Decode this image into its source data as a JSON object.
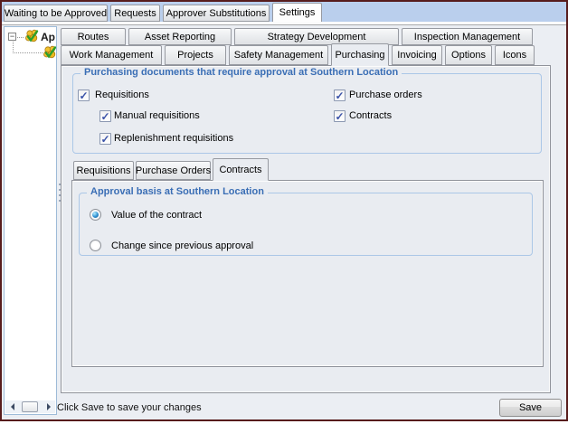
{
  "top_tabs": [
    {
      "label": "Waiting to be Approved",
      "active": false
    },
    {
      "label": "Requests",
      "active": false
    },
    {
      "label": "Approver Substitutions",
      "active": false
    },
    {
      "label": "Settings",
      "active": true
    }
  ],
  "tree": {
    "root_label": "Ap",
    "expander_glyph": "−"
  },
  "settings_tabs": {
    "row1": [
      {
        "label": "Routes"
      },
      {
        "label": "Asset Reporting"
      },
      {
        "label": "Strategy Development"
      },
      {
        "label": "Inspection Management"
      }
    ],
    "row2": [
      {
        "label": "Work Management",
        "active": false
      },
      {
        "label": "Projects",
        "active": false
      },
      {
        "label": "Safety Management",
        "active": false
      },
      {
        "label": "Purchasing",
        "active": true
      },
      {
        "label": "Invoicing",
        "active": false
      },
      {
        "label": "Options",
        "active": false
      },
      {
        "label": "Icons",
        "active": false
      }
    ]
  },
  "purchasing_page": {
    "group_title": "Purchasing documents that require approval at Southern Location",
    "checkboxes": [
      {
        "label": "Requisitions",
        "checked": true
      },
      {
        "label": "Manual requisitions",
        "checked": true
      },
      {
        "label": "Replenishment requisitions",
        "checked": true
      },
      {
        "label": "Purchase orders",
        "checked": true
      },
      {
        "label": "Contracts",
        "checked": true
      }
    ],
    "doc_tabs": [
      {
        "label": "Requisitions",
        "active": false
      },
      {
        "label": "Purchase Orders",
        "active": false
      },
      {
        "label": "Contracts",
        "active": true
      }
    ],
    "contracts_tab": {
      "group_title": "Approval basis at Southern Location",
      "radios": [
        {
          "label": "Value of the contract",
          "selected": true
        },
        {
          "label": "Change since previous approval",
          "selected": false
        }
      ]
    }
  },
  "status_bar": {
    "message": "Click Save to save your changes",
    "save_label": "Save"
  },
  "icons": {
    "check": "✓"
  },
  "colors": {
    "window_border": "#571c1c",
    "strip_bg": "#bacfed",
    "panel_bg": "#e9ecf1",
    "group_border": "#abc7e7",
    "group_title": "#3a6eb5",
    "check_glyph": "#3b53a8",
    "radio_dot": "#2e8fd0"
  }
}
